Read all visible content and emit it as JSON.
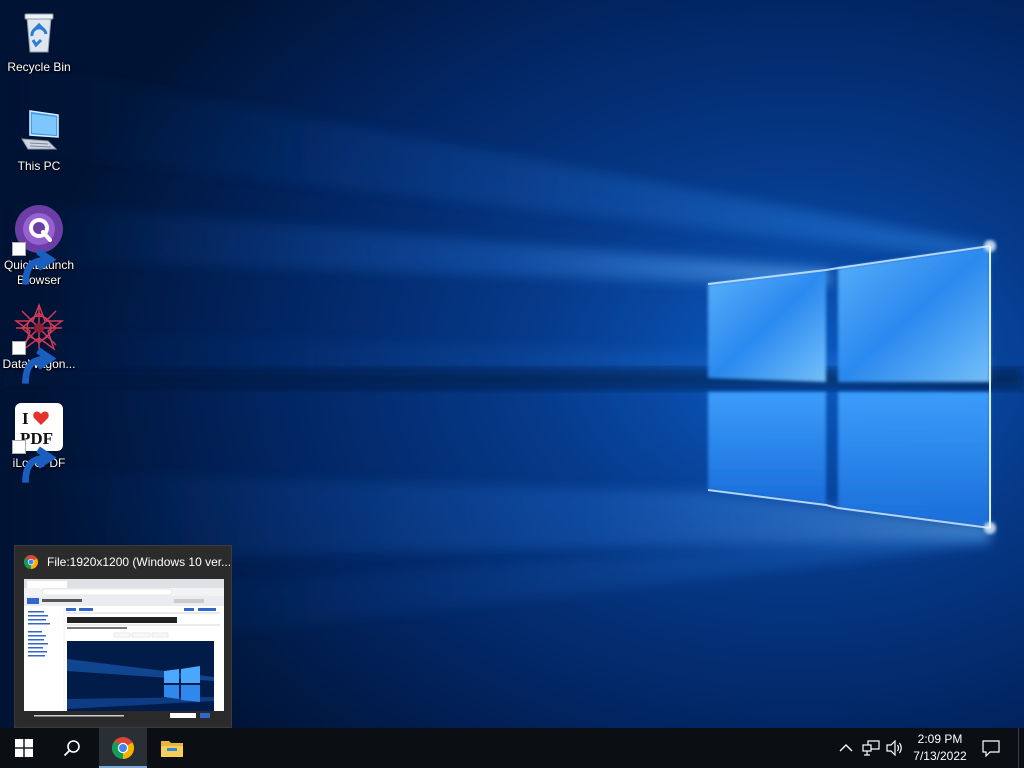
{
  "desktop": {
    "icons": [
      {
        "name": "Recycle Bin",
        "icon": "recycle-bin-icon"
      },
      {
        "name": "This PC",
        "icon": "this-pc-icon"
      },
      {
        "name": "QuickLaunch Browser",
        "icon": "quicklaunch-browser-icon"
      },
      {
        "name": "DataWagon...",
        "icon": "datawagon-icon"
      },
      {
        "name": "iLovePDF",
        "icon": "ilovepdf-icon",
        "logo_text": "I ❤ PDF"
      }
    ]
  },
  "preview": {
    "title": "File:1920x1200 (Windows 10 ver...",
    "icon": "chrome-icon"
  },
  "taskbar": {
    "start_icon": "windows-start-icon",
    "search_icon": "search-icon",
    "pinned": [
      {
        "name": "Google Chrome",
        "icon": "chrome-icon",
        "active": true
      },
      {
        "name": "File Explorer",
        "icon": "file-explorer-icon",
        "active": false
      }
    ],
    "tray": {
      "icons": [
        "chevron-up-icon",
        "network-icon",
        "volume-icon"
      ],
      "time": "2:09 PM",
      "date": "7/13/2022",
      "notification_icon": "action-center-icon"
    }
  },
  "colors": {
    "wallpaper_dark": "#00163d",
    "wallpaper_light": "#1f8fff",
    "taskbar": "#0b0f14",
    "taskbar_active": "#2a2f36",
    "accent": "#7aa7d8"
  }
}
